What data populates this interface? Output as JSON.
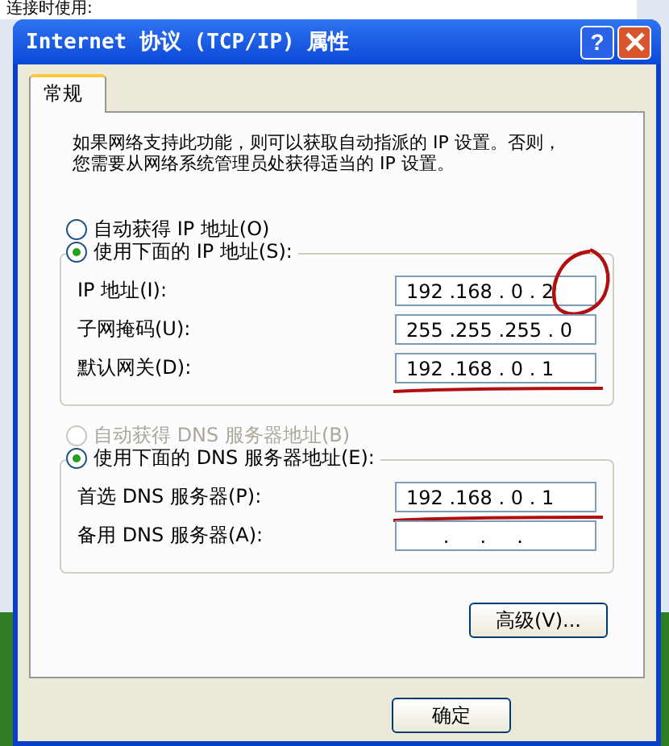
{
  "background_window": {
    "label": "连接时使用:"
  },
  "window": {
    "title": "Internet 协议 (TCP/IP) 属性",
    "help": "?"
  },
  "tabs": [
    {
      "label": "常规",
      "selected": true
    }
  ],
  "description_lines": [
    "如果网络支持此功能，则可以获取自动指派的 IP 设置。否则，",
    "您需要从网络系统管理员处获得适当的 IP 设置。"
  ],
  "ip_options": [
    {
      "label": "自动获得 IP 地址(O)",
      "selected": false,
      "disabled": false
    },
    {
      "label": "使用下面的 IP 地址(S):",
      "selected": true,
      "disabled": false
    }
  ],
  "ip_fields": [
    {
      "label": "IP 地址(I):",
      "value": "192 .168 . 0 . 2",
      "annotation": {
        "kind": "circle"
      }
    },
    {
      "label": "子网掩码(U):",
      "value": "255 .255 .255 . 0"
    },
    {
      "label": "默认网关(D):",
      "value": "192 .168 . 0 . 1",
      "annotation": {
        "kind": "underline"
      }
    }
  ],
  "dns_options": [
    {
      "label": "自动获得 DNS 服务器地址(B)",
      "selected": false,
      "disabled": true
    },
    {
      "label": "使用下面的 DNS 服务器地址(E):",
      "selected": true,
      "disabled": false
    }
  ],
  "dns_fields": [
    {
      "label": "首选 DNS 服务器(P):",
      "value": "192 .168 . 0 . 1",
      "annotation": {
        "kind": "underline"
      }
    },
    {
      "label": "备用 DNS 服务器(A):",
      "value": "      .     .     ."
    }
  ],
  "advanced_button": "高级(V)...",
  "ok_button": "确定"
}
